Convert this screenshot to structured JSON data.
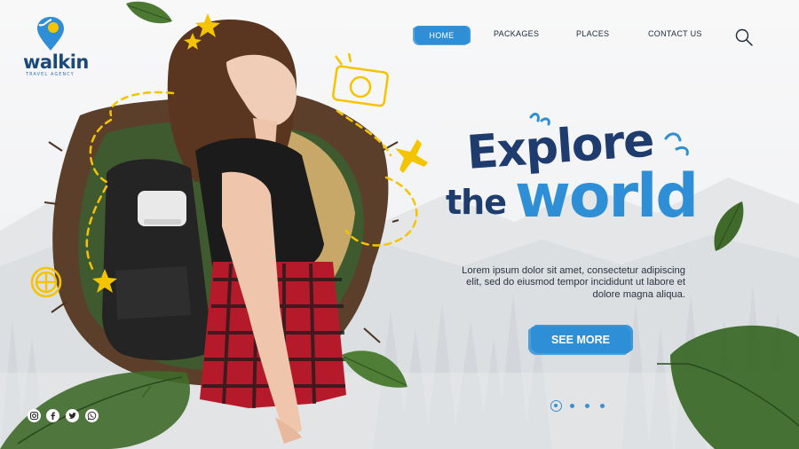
{
  "logo": {
    "name": "walkin",
    "tagline": "TRAVEL AGENCY"
  },
  "nav": {
    "items": [
      {
        "label": "HOME",
        "active": true
      },
      {
        "label": "PACKAGES"
      },
      {
        "label": "PLACES"
      },
      {
        "label": "CONTACT US"
      }
    ],
    "search_icon": "search-icon"
  },
  "hero": {
    "heading_line1": "Explore",
    "heading_line2_a": "the",
    "heading_line2_b": "world",
    "description": "Lorem ipsum dolor sit amet, consectetur adipiscing elit, sed do eiusmod tempor incididunt ut labore et dolore magna aliqua.",
    "cta_label": "SEE MORE"
  },
  "slider": {
    "count": 4,
    "active_index": 0
  },
  "social": [
    "instagram-icon",
    "facebook-icon",
    "twitter-icon",
    "whatsapp-icon"
  ],
  "colors": {
    "accent": "#2f8fd6",
    "navy": "#1f3c6e",
    "doodle": "#f5c400",
    "leaf": "#3f6a2a"
  }
}
